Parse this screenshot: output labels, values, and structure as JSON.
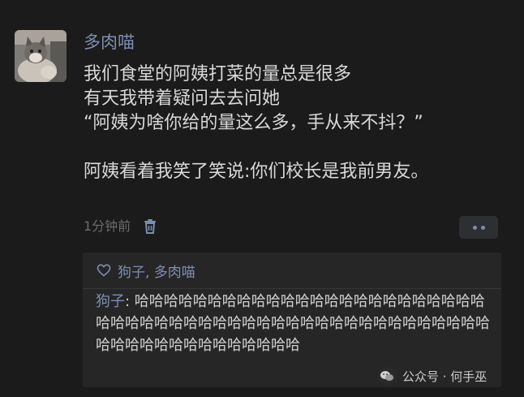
{
  "post": {
    "author": "多肉喵",
    "lines": [
      "我们食堂的阿姨打菜的量总是很多",
      "有天我带着疑问去去问她",
      "“阿姨为啥你给的量这么多，手从来不抖？”",
      "",
      "阿姨看着我笑了笑说:你们校长是我前男友。"
    ],
    "time": "1分钟前"
  },
  "icons": {
    "avatar": "cat-photo",
    "delete": "trash-icon",
    "more": "more-dots-icon",
    "like": "heart-icon",
    "watermark": "wechat-logo"
  },
  "interaction": {
    "likes": "狗子, 多肉喵",
    "comment": {
      "author": "狗子",
      "separator": ": ",
      "text": "哈哈哈哈哈哈哈哈哈哈哈哈哈哈哈哈哈哈哈哈哈哈哈哈哈哈哈哈哈哈哈哈哈哈哈哈哈哈哈哈哈哈哈哈哈哈哈哈哈哈哈哈哈哈哈哈哈哈哈哈哈哈哈哈哈"
    }
  },
  "watermark": {
    "text": "公众号 · 何手巫"
  },
  "colors": {
    "background": "#1b1b1b",
    "name_link": "#7f8db1",
    "body_text": "#d9d9d9",
    "muted": "#6c6c6c",
    "card": "#262626"
  }
}
